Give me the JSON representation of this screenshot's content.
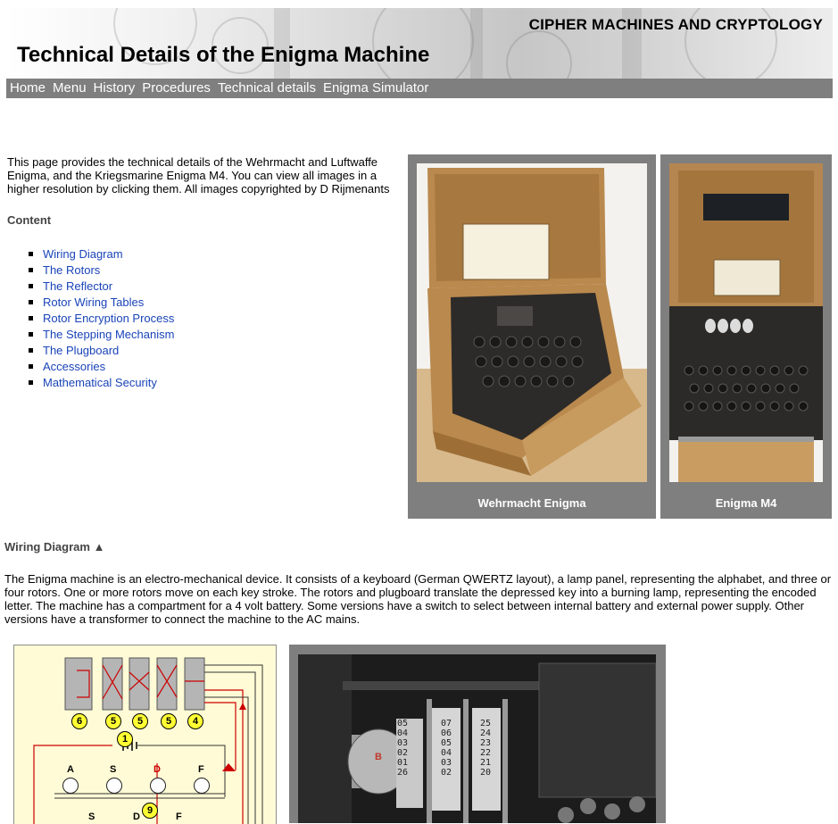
{
  "header": {
    "site_title": "CIPHER MACHINES AND CRYPTOLOGY",
    "page_title": "Technical Details of the Enigma Machine"
  },
  "nav": {
    "items": [
      "Home",
      "Menu",
      "History",
      "Procedures",
      "Technical details",
      "Enigma Simulator"
    ]
  },
  "intro": {
    "text": "This page provides the technical details of the Wehrmacht and Luftwaffe Enigma, and the Kriegsmarine Enigma M4. You can view all images in a higher resolution by clicking them. All images copyrighted by D Rijmenants"
  },
  "content": {
    "heading": "Content",
    "items": [
      "Wiring Diagram",
      "The Rotors",
      "The Reflector",
      "Rotor Wiring Tables",
      "Rotor Encryption Process",
      "The Stepping Mechanism",
      "The Plugboard",
      "Accessories",
      "Mathematical Security"
    ]
  },
  "photos": {
    "wehrmacht_caption": "Wehrmacht Enigma",
    "m4_caption": "Enigma M4"
  },
  "section": {
    "heading": "Wiring Diagram",
    "up_arrow": "▲",
    "text": "The Enigma machine is an electro-mechanical device. It consists of a keyboard (German QWERTZ layout), a lamp panel, representing the alphabet, and three or four rotors. One or more rotors move on each key stroke. The rotors and plugboard translate the depressed key into a burning lamp, representing the encoded letter. The machine has a compartment for a 4 volt battery. Some versions have a switch to select between internal battery and external power supply. Other versions have a transformer to connect the machine to the AC mains."
  },
  "diagram": {
    "rotor_numbers": [
      "6",
      "5",
      "5",
      "5",
      "4"
    ],
    "battery_number": "1",
    "lamp_letters": [
      "A",
      "S",
      "D",
      "F"
    ],
    "key_letters": [
      "S",
      "D",
      "F"
    ],
    "key_number": "9"
  },
  "rotor_photo": {
    "ring_left": [
      "05",
      "04",
      "03",
      "02",
      "01",
      "26"
    ],
    "ring_mid": [
      "07",
      "06",
      "05",
      "04",
      "03",
      "02"
    ],
    "ring_right": [
      "25",
      "24",
      "23",
      "22",
      "21",
      "20"
    ],
    "label": "B"
  },
  "colors": {
    "nav_bg": "#7f7f7f",
    "link": "#1a44b8",
    "diagram_bg": "#fffbd6",
    "wire_red": "#cc0000",
    "badge_yellow": "#ffff33"
  }
}
